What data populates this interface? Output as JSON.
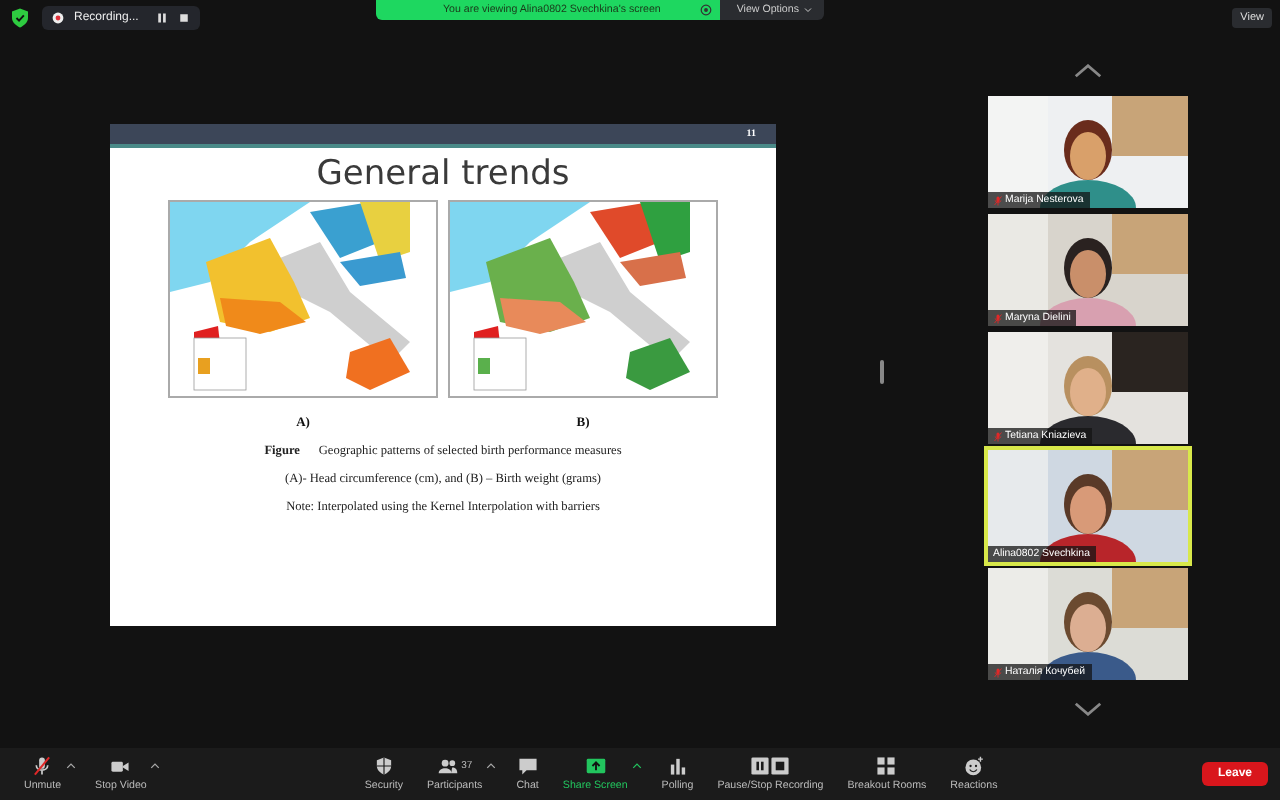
{
  "top_bar": {
    "recording_label": "Recording...",
    "banner": "You are viewing Alina0802 Svechkina's screen",
    "view_options": "View Options",
    "view_button": "View"
  },
  "slide": {
    "page_number": "11",
    "title": "General trends",
    "maps": [
      {
        "label": "A)"
      },
      {
        "label": "B)"
      }
    ],
    "caption": [
      "**Figure**      Geographic patterns of selected birth performance measures",
      "(A)- Head circumference (cm), and (B) – Birth weight (grams)",
      "Note: Interpolated using the Kernel Interpolation with barriers"
    ]
  },
  "participants": [
    {
      "name": "Marija Nesterova",
      "muted": true,
      "selected": false
    },
    {
      "name": "Maryna Dielini",
      "muted": true,
      "selected": false
    },
    {
      "name": "Tetiana Kniazieva",
      "muted": true,
      "selected": false
    },
    {
      "name": "Alina0802 Svechkina",
      "muted": false,
      "selected": true
    },
    {
      "name": "Наталія Кочубей",
      "muted": true,
      "selected": false
    }
  ],
  "toolbar": [
    {
      "kind": "mic",
      "label": "Unmute",
      "muted": true,
      "menu": true
    },
    {
      "kind": "video",
      "label": "Stop Video",
      "menu": true
    },
    {
      "kind": "security",
      "label": "Security",
      "menu": false
    },
    {
      "kind": "participants",
      "label": "Participants",
      "count": "37",
      "menu": true
    },
    {
      "kind": "chat",
      "label": "Chat",
      "menu": false
    },
    {
      "kind": "share",
      "label": "Share Screen",
      "menu": true
    },
    {
      "kind": "polling",
      "label": "Polling",
      "menu": false
    },
    {
      "kind": "recording",
      "label": "Pause/Stop Recording",
      "menu": false
    },
    {
      "kind": "breakout",
      "label": "Breakout Rooms",
      "menu": false
    },
    {
      "kind": "reactions",
      "label": "Reactions",
      "menu": false
    }
  ],
  "leave_button": "Leave"
}
